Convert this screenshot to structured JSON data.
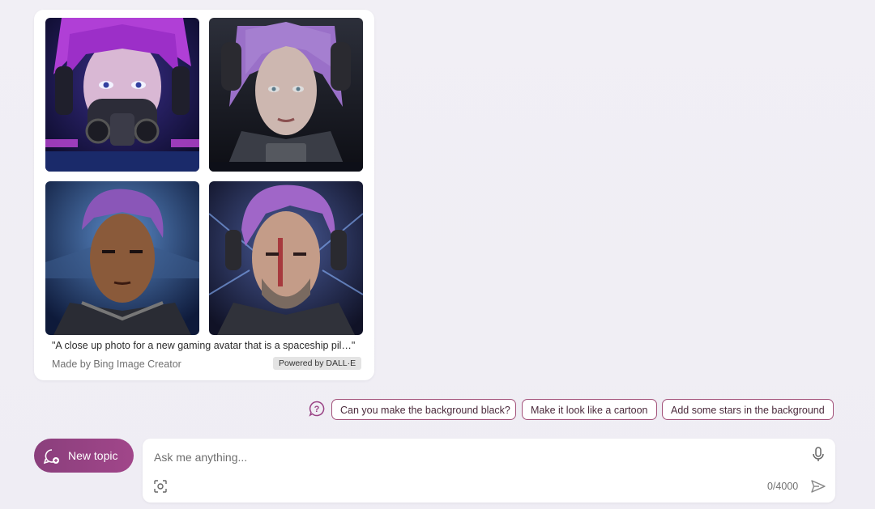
{
  "image_card": {
    "images": [
      {
        "alt": "Woman with purple hair wearing gas mask and headphones"
      },
      {
        "alt": "Woman with purple hair in space armor"
      },
      {
        "alt": "Man with purple hair in spacesuit"
      },
      {
        "alt": "Bearded man with purple hair and headset"
      }
    ],
    "caption": "\"A close up photo for a new gaming avatar that is a spaceship pil…\"",
    "made_by": "Made by Bing Image Creator",
    "powered_by": "Powered by DALL·E"
  },
  "suggestions": {
    "help_icon": "question-icon",
    "chips": [
      {
        "label": "Can you make the background black?"
      },
      {
        "label": "Make it look like a cartoon"
      },
      {
        "label": "Add some stars in the background"
      }
    ]
  },
  "composer": {
    "new_topic_label": "New topic",
    "placeholder": "Ask me anything...",
    "counter": "0/4000",
    "icons": [
      "broom-chat-icon",
      "mic-icon",
      "visual-search-icon",
      "send-icon"
    ]
  },
  "colors": {
    "accent": "#9a4385",
    "chip_border": "#a3527a",
    "background": "#f0eef4"
  }
}
